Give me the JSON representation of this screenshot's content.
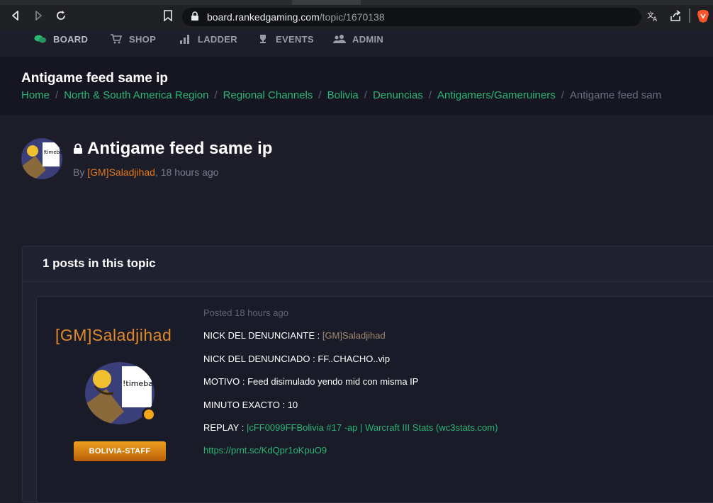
{
  "browser": {
    "url_domain": "board.rankedgaming.com",
    "url_path": "/topic/1670138",
    "icons": [
      "back-icon",
      "forward-icon",
      "reload-icon",
      "bookmark-icon",
      "lock-icon",
      "translate-icon",
      "share-icon",
      "brave-icon"
    ]
  },
  "nav": {
    "items": [
      {
        "label": "BOARD",
        "icon": "chat-icon"
      },
      {
        "label": "SHOP",
        "icon": "cart-icon"
      },
      {
        "label": "LADDER",
        "icon": "bar-chart-icon"
      },
      {
        "label": "EVENTS",
        "icon": "trophy-icon"
      },
      {
        "label": "ADMIN",
        "icon": "users-icon"
      }
    ]
  },
  "header": {
    "title": "Antigame feed same ip",
    "breadcrumb": [
      "Home",
      "North & South America Region",
      "Regional Channels",
      "Bolivia",
      "Denuncias",
      "Antigamers/Gameruiners"
    ],
    "breadcrumb_current": "Antigame feed sam"
  },
  "topic": {
    "title": "Antigame feed same ip",
    "by": "By",
    "author": "[GM]Saladjihad",
    "time": ", 18 hours ago"
  },
  "posts": {
    "count_label": "1 posts in this topic",
    "post": {
      "author": "[GM]Saladjihad",
      "avatar_text": "!timeban",
      "badge": "BOLIVIA-STAFF",
      "posted": "Posted 18 hours ago",
      "lines": {
        "l1_label": "NICK DEL DENUNCIANTE : ",
        "l1_value": "[GM]Saladjihad",
        "l2": "NICK  DEL DENUNCIADO : FF..CHACHO..vip",
        "l3": "MOTIVO : Feed disimulado yendo mid con misma IP",
        "l4": "MINUTO EXACTO : 10",
        "l5_label": "REPLAY : ",
        "l5_link": "|cFF0099FFBolivia #17 -ap | Warcraft III Stats (wc3stats.com)",
        "l6_link": "https://prnt.sc/KdQpr1oKpuO9"
      }
    }
  },
  "colors": {
    "accent_green": "#2bb673",
    "accent_orange": "#e0882a",
    "bg": "#1c1d28"
  }
}
